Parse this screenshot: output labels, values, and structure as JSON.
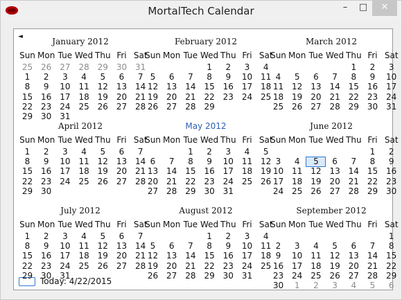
{
  "window": {
    "title": "MortalTech Calendar",
    "min_label": "–",
    "max_label": "□",
    "close_label": "✕"
  },
  "nav": {
    "prev": "◄"
  },
  "weekday_labels": [
    "Sun",
    "Mon",
    "Tue",
    "Wed",
    "Thu",
    "Fri",
    "Sat"
  ],
  "today_label": "Today: 4/22/2015",
  "months": [
    {
      "name": "January 2012",
      "current": false,
      "leading": [
        "25",
        "26",
        "27",
        "28",
        "29",
        "30",
        "31"
      ],
      "days": 31,
      "start": 0,
      "trailing": []
    },
    {
      "name": "February 2012",
      "current": false,
      "leading": [],
      "days": 29,
      "start": 3,
      "trailing": []
    },
    {
      "name": "March 2012",
      "current": false,
      "leading": [],
      "days": 31,
      "start": 4,
      "trailing": []
    },
    {
      "name": "April 2012",
      "current": false,
      "leading": [],
      "days": 30,
      "start": 0,
      "trailing": []
    },
    {
      "name": "May 2012",
      "current": true,
      "leading": [],
      "days": 31,
      "start": 2,
      "trailing": []
    },
    {
      "name": "June 2012",
      "current": false,
      "leading": [],
      "days": 30,
      "start": 5,
      "trailing": []
    },
    {
      "name": "July 2012",
      "current": false,
      "leading": [],
      "days": 31,
      "start": 0,
      "trailing": []
    },
    {
      "name": "August 2012",
      "current": false,
      "leading": [],
      "days": 31,
      "start": 3,
      "trailing": []
    },
    {
      "name": "September 2012",
      "current": false,
      "leading": [],
      "days": 30,
      "start": 6,
      "trailing": [
        "1",
        "2",
        "3",
        "4",
        "5",
        "6"
      ]
    }
  ],
  "highlighted_day": {
    "month_index": 5,
    "day": "5"
  }
}
